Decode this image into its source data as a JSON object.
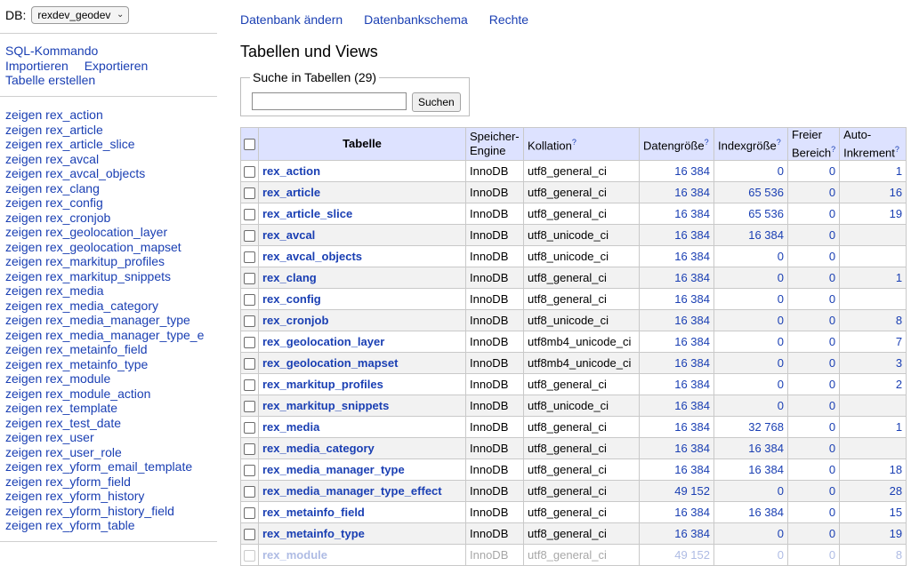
{
  "sidebar": {
    "db_label": "DB:",
    "db_selected": "rexdev_geodev",
    "sql_command": "SQL-Kommando",
    "import": "Importieren",
    "export": "Exportieren",
    "create_table": "Tabelle erstellen",
    "show_prefix": "zeigen",
    "tables": [
      "rex_action",
      "rex_article",
      "rex_article_slice",
      "rex_avcal",
      "rex_avcal_objects",
      "rex_clang",
      "rex_config",
      "rex_cronjob",
      "rex_geolocation_layer",
      "rex_geolocation_mapset",
      "rex_markitup_profiles",
      "rex_markitup_snippets",
      "rex_media",
      "rex_media_category",
      "rex_media_manager_type",
      "rex_media_manager_type_effect",
      "rex_metainfo_field",
      "rex_metainfo_type",
      "rex_module",
      "rex_module_action",
      "rex_template",
      "rex_test_date",
      "rex_user",
      "rex_user_role",
      "rex_yform_email_template",
      "rex_yform_field",
      "rex_yform_history",
      "rex_yform_history_field",
      "rex_yform_table"
    ],
    "tables_visible_text": [
      "rex_action",
      "rex_article",
      "rex_article_slice",
      "rex_avcal",
      "rex_avcal_objects",
      "rex_clang",
      "rex_config",
      "rex_cronjob",
      "rex_geolocation_layer",
      "rex_geolocation_mapset",
      "rex_markitup_profiles",
      "rex_markitup_snippets",
      "rex_media",
      "rex_media_category",
      "rex_media_manager_type",
      "rex_media_manager_type_e",
      "rex_metainfo_field",
      "rex_metainfo_type",
      "rex_module",
      "rex_module_action",
      "rex_template",
      "rex_test_date",
      "rex_user",
      "rex_user_role",
      "rex_yform_email_template",
      "rex_yform_field",
      "rex_yform_history",
      "rex_yform_history_field",
      "rex_yform_table"
    ]
  },
  "nav": {
    "alter_db": "Datenbank ändern",
    "schema": "Datenbankschema",
    "rights": "Rechte"
  },
  "main": {
    "title": "Tabellen und Views",
    "search_legend": "Suche in Tabellen (29)",
    "search_value": "",
    "search_button": "Suchen"
  },
  "table": {
    "headers": {
      "name": "Tabelle",
      "engine_1": "Speicher-",
      "engine_2": "Engine",
      "collation": "Kollation",
      "data_size": "Datengröße",
      "index_size": "Indexgröße",
      "free_1": "Freier",
      "free_2": "Bereich",
      "auto_1": "Auto-",
      "auto_2": "Inkrement",
      "help_mark": "?"
    },
    "rows": [
      {
        "name": "rex_action",
        "engine": "InnoDB",
        "coll": "utf8_general_ci",
        "data": "16 384",
        "index": "0",
        "free": "0",
        "auto": "1"
      },
      {
        "name": "rex_article",
        "engine": "InnoDB",
        "coll": "utf8_general_ci",
        "data": "16 384",
        "index": "65 536",
        "free": "0",
        "auto": "16"
      },
      {
        "name": "rex_article_slice",
        "engine": "InnoDB",
        "coll": "utf8_general_ci",
        "data": "16 384",
        "index": "65 536",
        "free": "0",
        "auto": "19"
      },
      {
        "name": "rex_avcal",
        "engine": "InnoDB",
        "coll": "utf8_unicode_ci",
        "data": "16 384",
        "index": "16 384",
        "free": "0",
        "auto": ""
      },
      {
        "name": "rex_avcal_objects",
        "engine": "InnoDB",
        "coll": "utf8_unicode_ci",
        "data": "16 384",
        "index": "0",
        "free": "0",
        "auto": ""
      },
      {
        "name": "rex_clang",
        "engine": "InnoDB",
        "coll": "utf8_general_ci",
        "data": "16 384",
        "index": "0",
        "free": "0",
        "auto": "1"
      },
      {
        "name": "rex_config",
        "engine": "InnoDB",
        "coll": "utf8_general_ci",
        "data": "16 384",
        "index": "0",
        "free": "0",
        "auto": ""
      },
      {
        "name": "rex_cronjob",
        "engine": "InnoDB",
        "coll": "utf8_unicode_ci",
        "data": "16 384",
        "index": "0",
        "free": "0",
        "auto": "8"
      },
      {
        "name": "rex_geolocation_layer",
        "engine": "InnoDB",
        "coll": "utf8mb4_unicode_ci",
        "data": "16 384",
        "index": "0",
        "free": "0",
        "auto": "7"
      },
      {
        "name": "rex_geolocation_mapset",
        "engine": "InnoDB",
        "coll": "utf8mb4_unicode_ci",
        "data": "16 384",
        "index": "0",
        "free": "0",
        "auto": "3"
      },
      {
        "name": "rex_markitup_profiles",
        "engine": "InnoDB",
        "coll": "utf8_general_ci",
        "data": "16 384",
        "index": "0",
        "free": "0",
        "auto": "2"
      },
      {
        "name": "rex_markitup_snippets",
        "engine": "InnoDB",
        "coll": "utf8_unicode_ci",
        "data": "16 384",
        "index": "0",
        "free": "0",
        "auto": ""
      },
      {
        "name": "rex_media",
        "engine": "InnoDB",
        "coll": "utf8_general_ci",
        "data": "16 384",
        "index": "32 768",
        "free": "0",
        "auto": "1"
      },
      {
        "name": "rex_media_category",
        "engine": "InnoDB",
        "coll": "utf8_general_ci",
        "data": "16 384",
        "index": "16 384",
        "free": "0",
        "auto": ""
      },
      {
        "name": "rex_media_manager_type",
        "engine": "InnoDB",
        "coll": "utf8_general_ci",
        "data": "16 384",
        "index": "16 384",
        "free": "0",
        "auto": "18"
      },
      {
        "name": "rex_media_manager_type_effect",
        "engine": "InnoDB",
        "coll": "utf8_general_ci",
        "data": "49 152",
        "index": "0",
        "free": "0",
        "auto": "28"
      },
      {
        "name": "rex_metainfo_field",
        "engine": "InnoDB",
        "coll": "utf8_general_ci",
        "data": "16 384",
        "index": "16 384",
        "free": "0",
        "auto": "15"
      },
      {
        "name": "rex_metainfo_type",
        "engine": "InnoDB",
        "coll": "utf8_general_ci",
        "data": "16 384",
        "index": "0",
        "free": "0",
        "auto": "19"
      },
      {
        "name": "rex_module",
        "engine": "InnoDB",
        "coll": "utf8_general_ci",
        "data": "49 152",
        "index": "0",
        "free": "0",
        "auto": "8"
      }
    ]
  },
  "colors": {
    "link": "#1a3fb3",
    "header_bg": "#dde2ff",
    "row_alt": "#f2f2f2"
  }
}
